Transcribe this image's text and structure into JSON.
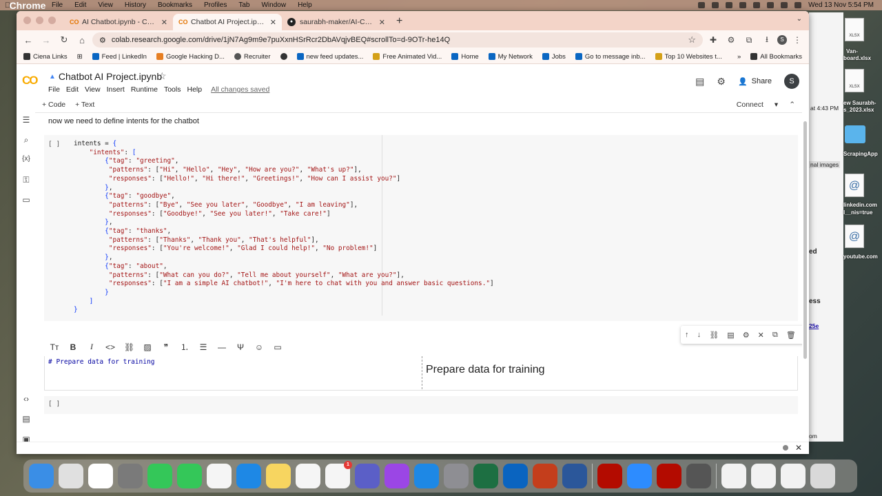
{
  "menubar": {
    "apple": "",
    "items": [
      "Chrome",
      "File",
      "Edit",
      "View",
      "History",
      "Bookmarks",
      "Profiles",
      "Tab",
      "Window",
      "Help"
    ],
    "clock": "Wed 13 Nov  5:54 PM"
  },
  "browser": {
    "tabs": [
      {
        "title": "AI Chatbot.ipynb - Colab",
        "icon": "CO"
      },
      {
        "title": "Chatbot AI Project.ipynb - Co",
        "icon": "CO"
      },
      {
        "title": "saurabh-maker/AI-Chatbot",
        "icon": "gh"
      }
    ],
    "url": "colab.research.google.com/drive/1jN7Ag9m9e7puXxnHSrRcr2DbAVqjvBEQ#scrollTo=d-9OTr-he14Q",
    "profile_initial": "S",
    "bookmarks": [
      "Ciena Links",
      "Feed | LinkedIn",
      "Google Hacking D...",
      "Recruiter",
      "new feed updates...",
      "Free Animated Vid...",
      "Home",
      "My Network",
      "Jobs",
      "Go to message inb...",
      "Top 10 Websites t..."
    ],
    "all_bookmarks": "All Bookmarks"
  },
  "colab": {
    "logo": "CO",
    "title": "Chatbot AI Project.ipynb",
    "menus": [
      "File",
      "Edit",
      "View",
      "Insert",
      "Runtime",
      "Tools",
      "Help"
    ],
    "saved": "All changes saved",
    "share": "Share",
    "avatar": "S",
    "add_code": "+ Code",
    "add_text": "+ Text",
    "connect": "Connect"
  },
  "notebook": {
    "intro_text": "now we need to define intents for the chatbot",
    "run_indicator": "[ ]",
    "md_source": "# Prepare data for training",
    "md_preview": "Prepare data for training",
    "empty_indicator": "[ ]"
  },
  "background_window": {
    "fragments": [
      "at 4:43 PM",
      "nal images",
      "ed",
      "ess",
      "25e",
      "om"
    ]
  },
  "desktop": {
    "labels": [
      "Van-",
      "board.xlsx",
      "ew Saurabh-",
      "s_2023.xlsx",
      "ScrapingApp",
      "linkedin.com",
      "l__nis=true",
      "youtube.com"
    ]
  },
  "dock": {
    "apps": [
      {
        "name": "finder",
        "color": "#3a8ee6"
      },
      {
        "name": "chrome",
        "color": "#e0e0e0"
      },
      {
        "name": "slack",
        "color": "#ffffff"
      },
      {
        "name": "launchpad",
        "color": "#7a7a7a"
      },
      {
        "name": "facetime",
        "color": "#34c759"
      },
      {
        "name": "messages",
        "color": "#34c759"
      },
      {
        "name": "photos",
        "color": "#f5f5f5"
      },
      {
        "name": "edge",
        "color": "#1e88e5"
      },
      {
        "name": "notes",
        "color": "#f7d560"
      },
      {
        "name": "freeform",
        "color": "#f5f5f5"
      },
      {
        "name": "reminders",
        "color": "#f5f5f5"
      },
      {
        "name": "teams",
        "color": "#5b5fc7"
      },
      {
        "name": "podcasts",
        "color": "#9b46e5"
      },
      {
        "name": "app-store",
        "color": "#1e88e5"
      },
      {
        "name": "system-settings",
        "color": "#8e8e93"
      },
      {
        "name": "excel",
        "color": "#1d6f42"
      },
      {
        "name": "outlook",
        "color": "#0a64c0"
      },
      {
        "name": "powerpoint",
        "color": "#c43e1c"
      },
      {
        "name": "word",
        "color": "#2b579a"
      },
      {
        "name": "acrobat",
        "color": "#b30b00"
      },
      {
        "name": "zoom",
        "color": "#2d8cff"
      },
      {
        "name": "acrobat-2",
        "color": "#b30b00"
      },
      {
        "name": "quicktime",
        "color": "#555555"
      }
    ],
    "badge_count": "1"
  }
}
